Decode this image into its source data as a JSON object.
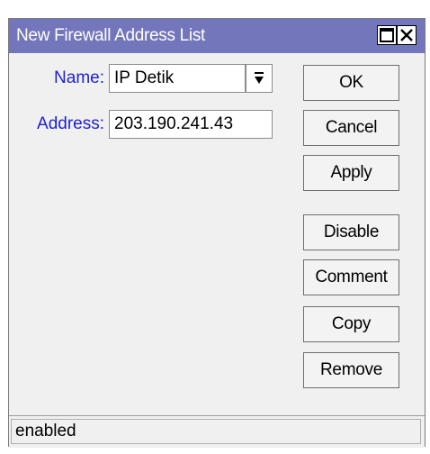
{
  "window": {
    "title": "New Firewall Address List",
    "title_bar_color": "#7476bb"
  },
  "form": {
    "name_label": "Name:",
    "name_value": "IP Detik",
    "address_label": "Address:",
    "address_value": "203.190.241.43"
  },
  "buttons": {
    "ok": "OK",
    "cancel": "Cancel",
    "apply": "Apply",
    "disable": "Disable",
    "comment": "Comment",
    "copy": "Copy",
    "remove": "Remove"
  },
  "status": {
    "text": "enabled"
  },
  "icons": {
    "maximize": "maximize-icon",
    "close": "close-icon",
    "dropdown": "dropdown-arrow-icon"
  },
  "colors": {
    "label_text": "#1f1fd8"
  }
}
